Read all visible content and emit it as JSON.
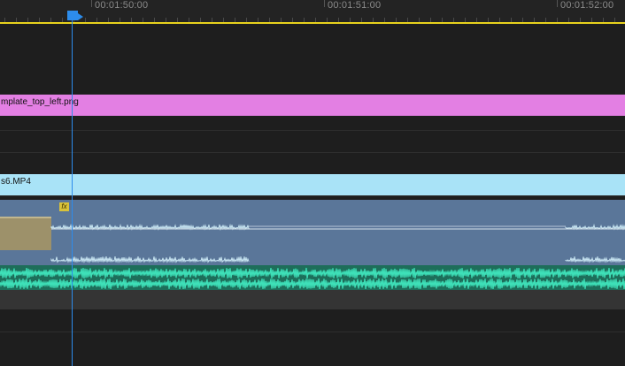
{
  "ruler": {
    "timecodes": [
      "00:01:50:00",
      "00:01:51:00",
      "00:01:52:00"
    ]
  },
  "tracks": {
    "graphic_clip": {
      "label": "mplate_top_left.png"
    },
    "video_clip": {
      "label": "s6.MP4"
    },
    "audio_clip": {
      "fx_label": "fx"
    }
  },
  "colors": {
    "playhead": "#2d8ceb",
    "work_area": "#e8d21d",
    "graphic_clip": "#e37fe3",
    "video_clip": "#a9e3f7",
    "audio_clip": "#5a7699",
    "audio_waveform": "#3ee0b8",
    "fx_badge": "#d8c23a"
  }
}
